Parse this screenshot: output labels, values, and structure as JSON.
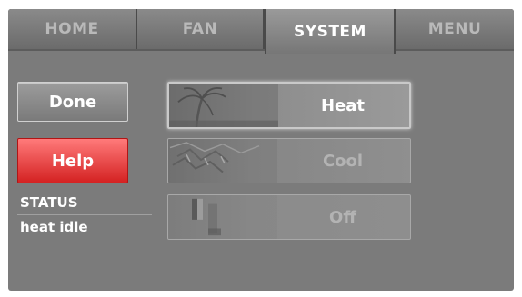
{
  "tabs": {
    "home": "HOME",
    "fan": "FAN",
    "system": "SYSTEM",
    "menu": "MENU",
    "active": "system"
  },
  "buttons": {
    "done": "Done",
    "help": "Help"
  },
  "status": {
    "title": "STATUS",
    "value": "heat idle"
  },
  "modes": {
    "heat": "Heat",
    "cool": "Cool",
    "off": "Off",
    "selected": "heat"
  },
  "colors": {
    "help_accent": "#d42222",
    "panel_bg": "#7b7b7b"
  }
}
